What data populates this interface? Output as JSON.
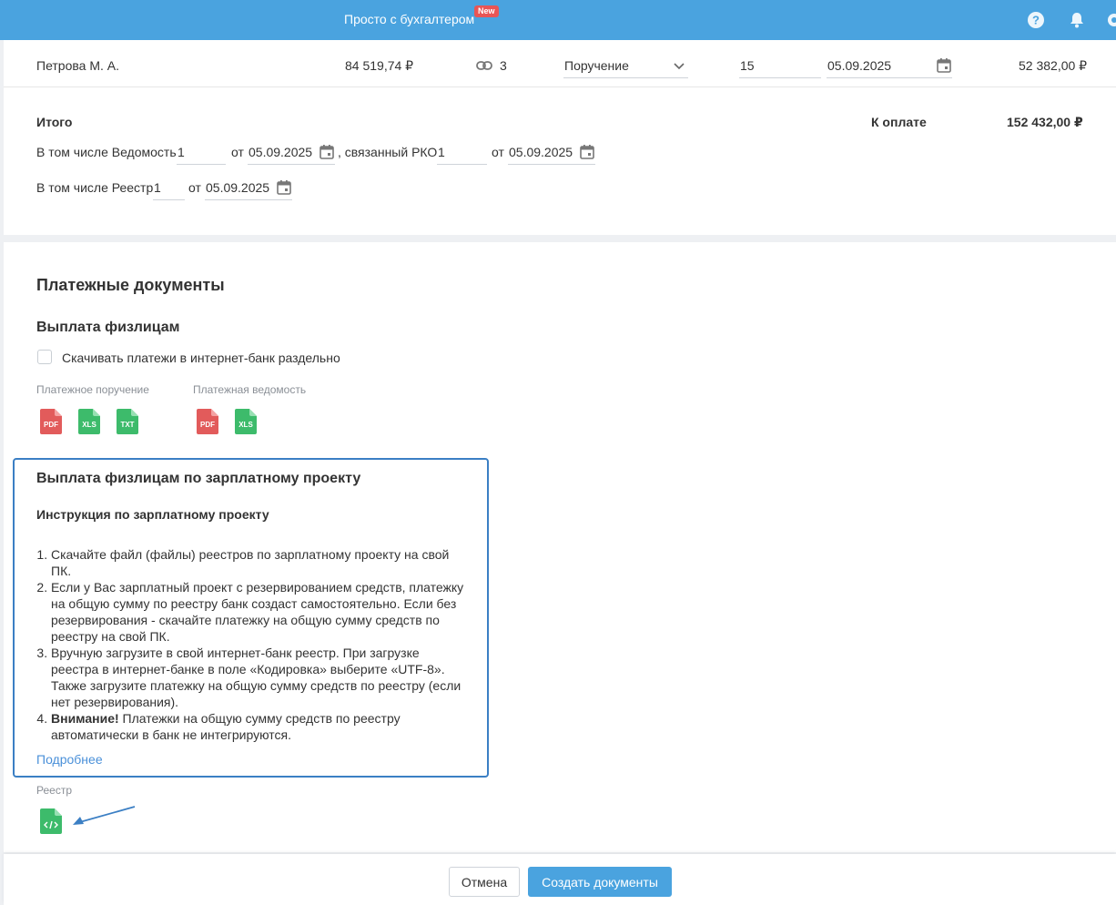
{
  "topbar": {
    "brand": "Просто с бухгалтером",
    "new_badge": "New",
    "icons": [
      "help-icon",
      "bell-icon",
      "settings-icon"
    ]
  },
  "employee_row": {
    "name": "Петрова М. А.",
    "amount": "84 519,74 ₽",
    "link_count": "3",
    "payment_type": "Поручение",
    "day": "15",
    "date": "05.09.2025",
    "to_pay": "52 382,00 ₽"
  },
  "totals": {
    "label": "Итого",
    "to_pay_label": "К оплате",
    "to_pay_value": "152 432,00 ₽",
    "vedomost_label": "В том числе Ведомость",
    "vedomost_number": "1",
    "from1": "от",
    "vedomost_date": "05.09.2025",
    "rko_label": ", связанный РКО",
    "rko_number": "1",
    "from2": "от",
    "rko_date": "05.09.2025",
    "reestr_label": "В том числе Реестр",
    "reestr_number": "1",
    "from3": "от",
    "reestr_date": "05.09.2025"
  },
  "payment_docs": {
    "title": "Платежные документы",
    "individuals_title": "Выплата физлицам",
    "separate_checkbox_label": "Скачивать платежи в интернет-банк раздельно",
    "separate_checked": false,
    "order_label": "Платежное поручение",
    "order_formats": [
      "PDF",
      "XLS",
      "TXT"
    ],
    "statement_label": "Платежная ведомость",
    "statement_formats": [
      "PDF",
      "XLS"
    ]
  },
  "salary_project": {
    "title": "Выплата физлицам по зарплатному проекту",
    "instruction_title": "Инструкция по зарплатному проекту",
    "steps": [
      "Скачайте файл (файлы) реестров по зарплатному проекту на свой ПК.",
      "Если у Вас зарплатный проект с резервированием средств, платежку на общую сумму по реестру банк создаст самостоятельно. Если без резервирования - скачайте платежку на общую сумму средств по реестру на свой ПК.",
      "Вручную загрузите в свой интернет-банк реестр. При загрузке реестра в интернет-банке в поле «Кодировка» выберите «UTF-8». Также загрузите платежку на общую сумму средств по реестру (если нет резервирования)."
    ],
    "step4_bold": "Внимание!",
    "step4_text": " Платежки на общую сумму средств по реестру автоматически в банк не интегрируются.",
    "more_link": "Подробнее",
    "registry_label": "Реестр",
    "registry_icon": "xml-file-icon"
  },
  "footer": {
    "cancel": "Отмена",
    "create": "Создать документы"
  },
  "colors": {
    "accent": "#4aa3df",
    "pdf": "#e25b5b",
    "xls": "#3dbb6b",
    "highlight_border": "#3b7fc4",
    "badge": "#e85555"
  }
}
